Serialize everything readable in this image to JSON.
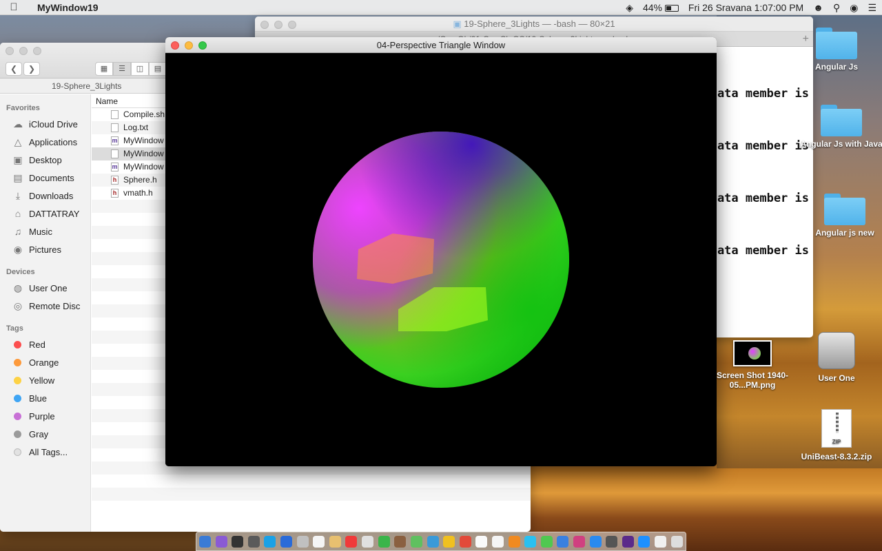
{
  "menubar": {
    "app_name": "MyWindow19",
    "battery": "44%",
    "datetime": "Fri 26 Sravana  1:07:00 PM"
  },
  "terminal": {
    "title": "19-Sphere_3Lights — -bash — 80×21",
    "tab_path": "/Gau  Ob/01-Cas  Ch     OS/19-Sphere_3Lights — -bash",
    "lines": [
      "data member is",
      "data member is",
      "data member is",
      "data member is"
    ]
  },
  "finder": {
    "path_title": "19-Sphere_3Lights",
    "favorites_heading": "Favorites",
    "favorites": [
      {
        "label": "iCloud Drive",
        "icon": "cloud-icon"
      },
      {
        "label": "Applications",
        "icon": "applications-icon"
      },
      {
        "label": "Desktop",
        "icon": "desktop-icon"
      },
      {
        "label": "Documents",
        "icon": "documents-icon"
      },
      {
        "label": "Downloads",
        "icon": "downloads-icon"
      },
      {
        "label": "DATTATRAY",
        "icon": "home-icon"
      },
      {
        "label": "Music",
        "icon": "music-icon"
      },
      {
        "label": "Pictures",
        "icon": "pictures-icon"
      }
    ],
    "devices_heading": "Devices",
    "devices": [
      {
        "label": "User One",
        "icon": "disk-icon"
      },
      {
        "label": "Remote Disc",
        "icon": "remote-disc-icon"
      }
    ],
    "tags_heading": "Tags",
    "tags": [
      {
        "label": "Red",
        "color": "#fc4f4f"
      },
      {
        "label": "Orange",
        "color": "#fd9a3c"
      },
      {
        "label": "Yellow",
        "color": "#fdd245"
      },
      {
        "label": "Blue",
        "color": "#3fa5f4"
      },
      {
        "label": "Purple",
        "color": "#c871d6"
      },
      {
        "label": "Gray",
        "color": "#9b9b9b"
      },
      {
        "label": "All Tags...",
        "color": "#e2e2e2"
      }
    ],
    "column_name": "Name",
    "files": [
      {
        "name": "Compile.sh",
        "badge": ""
      },
      {
        "name": "Log.txt",
        "badge": ""
      },
      {
        "name": "MyWindow",
        "badge": "m"
      },
      {
        "name": "MyWindow",
        "badge": "x"
      },
      {
        "name": "MyWindow",
        "badge": "m"
      },
      {
        "name": "Sphere.h",
        "badge": "h"
      },
      {
        "name": "vmath.h",
        "badge": "h"
      }
    ]
  },
  "gl_window": {
    "title": "04-Perspective Triangle Window"
  },
  "desktop": {
    "icons": [
      {
        "label": "Angular Js",
        "kind": "folder-icon"
      },
      {
        "label": "Angular Js with Java",
        "kind": "folder-icon"
      },
      {
        "label": "Angular js new",
        "kind": "folder-icon"
      },
      {
        "label": "Screen Shot 1940-05...PM.png",
        "kind": "image-icon"
      },
      {
        "label": "User One",
        "kind": "disk-icon"
      },
      {
        "label": "UniBeast-8.3.2.zip",
        "kind": "zip-icon"
      }
    ]
  },
  "dock": {
    "colors": [
      "#3a7bd5",
      "#8a5ad4",
      "#333333",
      "#5a5a5a",
      "#1aa1e6",
      "#2a6bd8",
      "#c0c0c0",
      "#f5f5f5",
      "#e8c070",
      "#f03a3a",
      "#e0e0e0",
      "#3ab54a",
      "#8a6040",
      "#60c060",
      "#3a9ad8",
      "#f0c020",
      "#e24a3a",
      "#fafafa",
      "#f5f5f5",
      "#f08a20",
      "#2ac0f0",
      "#50c850",
      "#3a80e0",
      "#d04080",
      "#2a8af0",
      "#555555",
      "#5a2a8a",
      "#1e90ff",
      "#f0f0f0",
      "#dddddd"
    ]
  }
}
